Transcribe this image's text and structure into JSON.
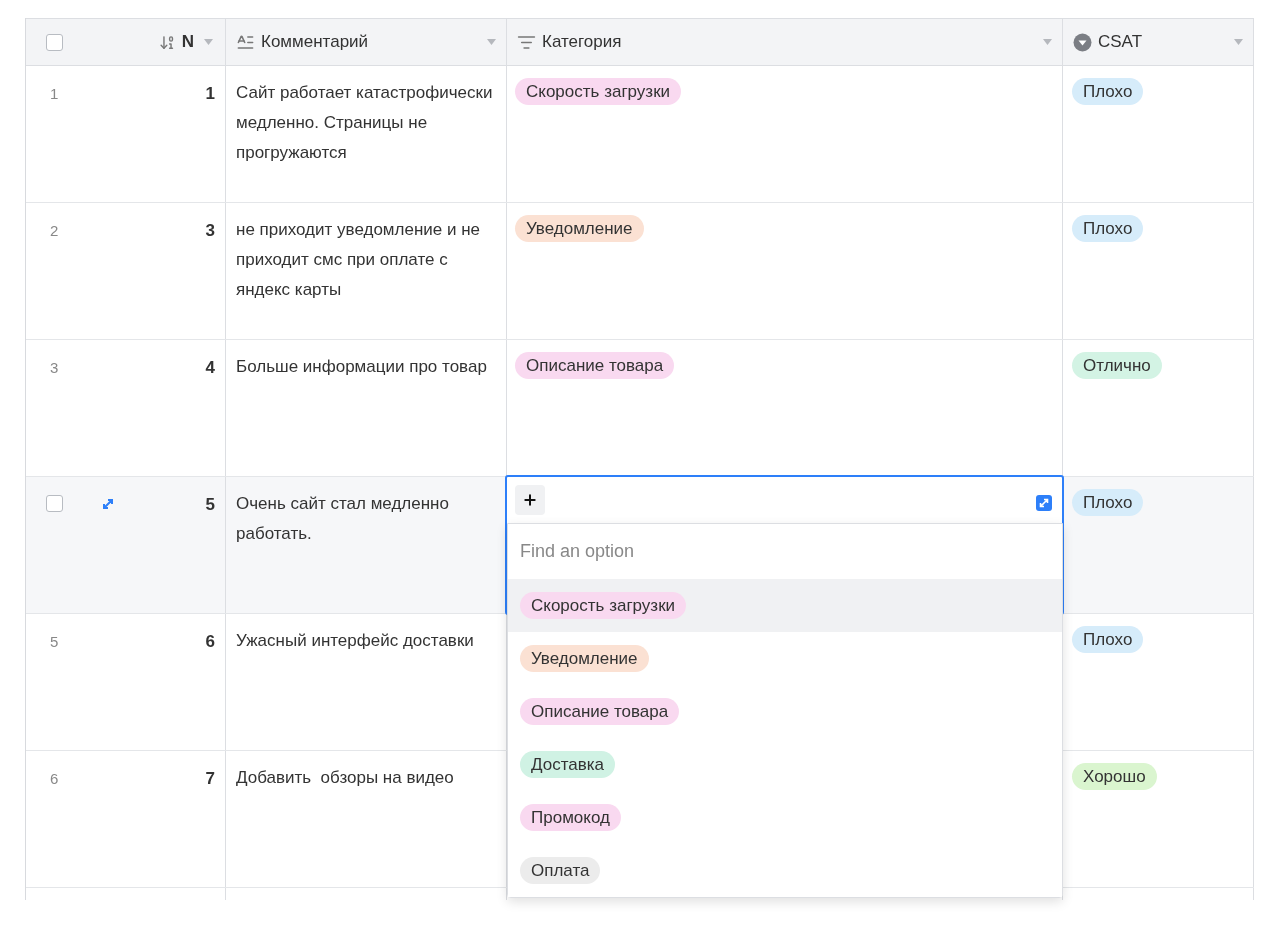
{
  "header": {
    "checkbox": {
      "checked": false
    },
    "columns": [
      {
        "label": "N",
        "kind": "number"
      },
      {
        "label": "Комментарий",
        "kind": "text"
      },
      {
        "label": "Категория",
        "kind": "multi"
      },
      {
        "label": "CSAT",
        "kind": "single"
      }
    ]
  },
  "rows": [
    {
      "index": "1",
      "n": "1",
      "comment": "Сайт работает катастрофически медленно. Страницы не прогружаются",
      "hovered": false,
      "category": {
        "label": "Скорость загрузки",
        "color": "#f9d9f0"
      },
      "csat": {
        "label": "Плохо",
        "color": "#d6ecfa"
      }
    },
    {
      "index": "2",
      "n": "3",
      "comment": "не приходит уведомление и не приходит смс при оплате с яндекс карты",
      "hovered": false,
      "category": {
        "label": "Уведомление",
        "color": "#fbe1d3"
      },
      "csat": {
        "label": "Плохо",
        "color": "#d6ecfa"
      }
    },
    {
      "index": "3",
      "n": "4",
      "comment": "Больше информации про товар",
      "hovered": false,
      "category": {
        "label": "Описание товара",
        "color": "#f9d9f0"
      },
      "csat": {
        "label": "Отлично",
        "color": "#d3f3e4"
      }
    },
    {
      "n": "5",
      "comment": "Очень сайт стал медленно работать.",
      "hovered": true,
      "checkbox": {
        "checked": false
      },
      "csat": {
        "label": "Плохо",
        "color": "#d6ecfa"
      },
      "editor": {
        "placeholder": "Find an option",
        "options": [
          {
            "label": "Скорость загрузки",
            "color": "#f9d9f0",
            "selected": true
          },
          {
            "label": "Уведомление",
            "color": "#fbe1d3",
            "selected": false
          },
          {
            "label": "Описание товара",
            "color": "#f9d9f0",
            "selected": false
          },
          {
            "label": "Доставка",
            "color": "#d0f2e4",
            "selected": false
          },
          {
            "label": "Промокод",
            "color": "#f9d9f0",
            "selected": false
          },
          {
            "label": "Оплата",
            "color": "#ececec",
            "selected": false
          }
        ]
      }
    },
    {
      "index": "5",
      "n": "6",
      "comment": "Ужасный интерфейс доставки",
      "hovered": false,
      "csat": {
        "label": "Плохо",
        "color": "#d6ecfa"
      }
    },
    {
      "index": "6",
      "n": "7",
      "comment": "Добавить  обзоры на видео",
      "hovered": false,
      "csat": {
        "label": "Хорошо",
        "color": "#daf5cf"
      }
    }
  ]
}
